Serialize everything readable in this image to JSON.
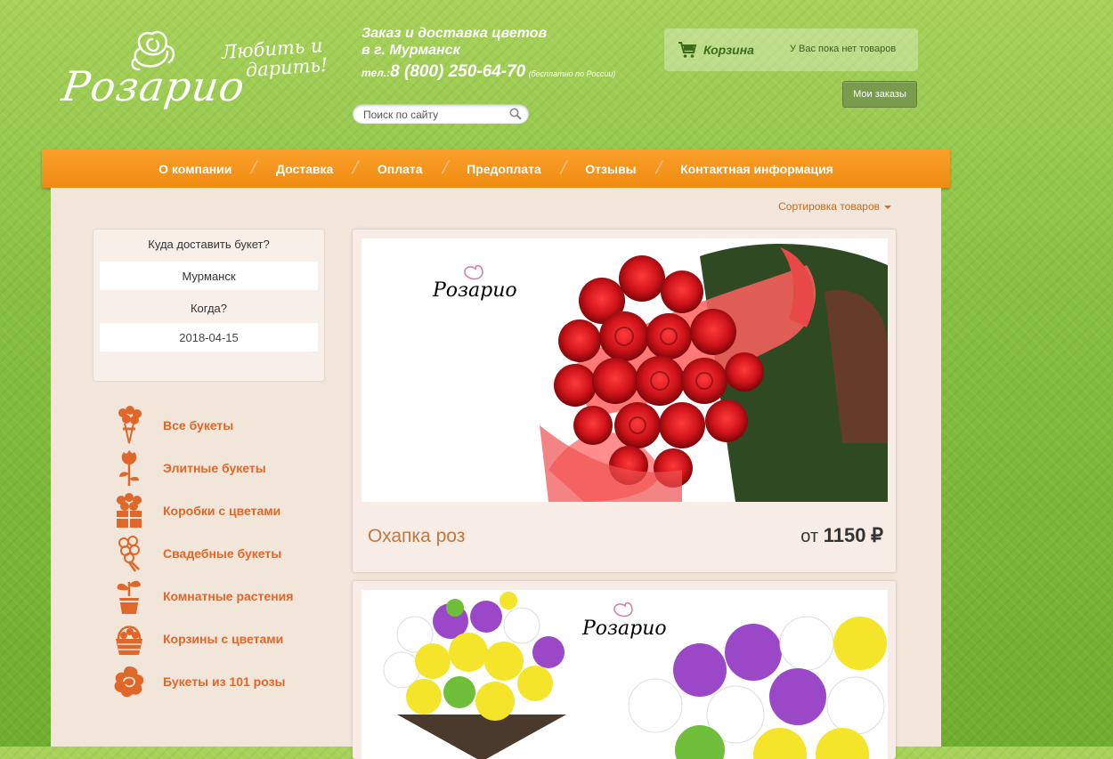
{
  "logo": {
    "text": "Розарио",
    "tagline_1": "Любить и",
    "tagline_2": "дарить!"
  },
  "info": {
    "line1": "Заказ и доставка цветов",
    "line2": "в г. Мурманск",
    "phone_prefix": "тел.:",
    "phone": "8 (800) 250-64-70",
    "phone_note": "(бесплатно по России)"
  },
  "search": {
    "placeholder": "Поиск по сайту"
  },
  "cart": {
    "label": "Корзина",
    "empty_text": "У Вас пока нет товаров",
    "orders_button": "Мои заказы"
  },
  "nav": {
    "items": [
      "О компании",
      "Доставка",
      "Оплата",
      "Предоплата",
      "Отзывы",
      "Контактная информация"
    ]
  },
  "sort": {
    "label": "Сортировка товаров"
  },
  "delivery": {
    "where_label": "Куда доставить букет?",
    "city": "Мурманск",
    "when_label": "Когда?",
    "date": "2018-04-15"
  },
  "categories": [
    {
      "label": "Все букеты",
      "icon": "bouquet-icon"
    },
    {
      "label": "Элитные букеты",
      "icon": "elite-rose-icon"
    },
    {
      "label": "Коробки с цветами",
      "icon": "flower-box-icon"
    },
    {
      "label": "Свадебные букеты",
      "icon": "wedding-bouquet-icon"
    },
    {
      "label": "Комнатные растения",
      "icon": "potted-plant-icon"
    },
    {
      "label": "Корзины с цветами",
      "icon": "flower-basket-icon"
    },
    {
      "label": "Букеты из 101 розы",
      "icon": "rose-101-icon"
    }
  ],
  "products": [
    {
      "name": "Охапка роз",
      "price_prefix": "от",
      "price": "1150",
      "currency": "₽",
      "image_brand": "Розарио"
    },
    {
      "image_brand": "Розарио"
    }
  ],
  "colors": {
    "accent_orange": "#f08a11",
    "category_text": "#e0672a",
    "background_green": "#86c041"
  }
}
